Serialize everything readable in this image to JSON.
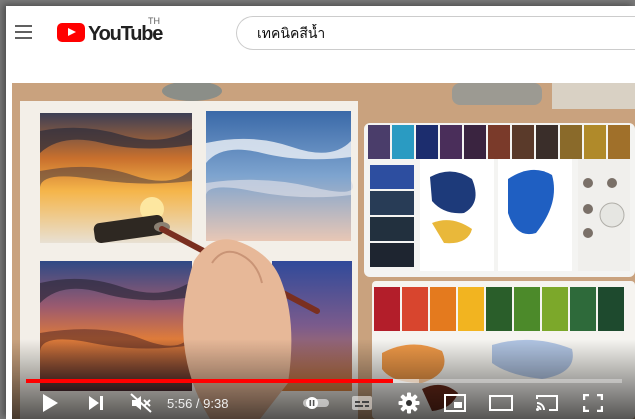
{
  "masthead": {
    "logo_text": "YouTube",
    "region": "TH",
    "search_value": "เทคนิคสีน้ำ"
  },
  "player": {
    "current_time": "5:56",
    "separator": " / ",
    "duration": "9:38",
    "played_fraction": 0.616,
    "loaded_fraction": 0.66
  },
  "colors": {
    "brand_red": "#ff0000",
    "progress_red": "#ff0000"
  },
  "icons": [
    "menu-icon",
    "youtube-logo-icon",
    "play-icon",
    "next-icon",
    "mute-icon",
    "autoplay-toggle-icon",
    "subtitles-icon",
    "settings-icon",
    "miniplayer-icon",
    "theater-mode-icon",
    "cast-icon",
    "fullscreen-icon"
  ]
}
